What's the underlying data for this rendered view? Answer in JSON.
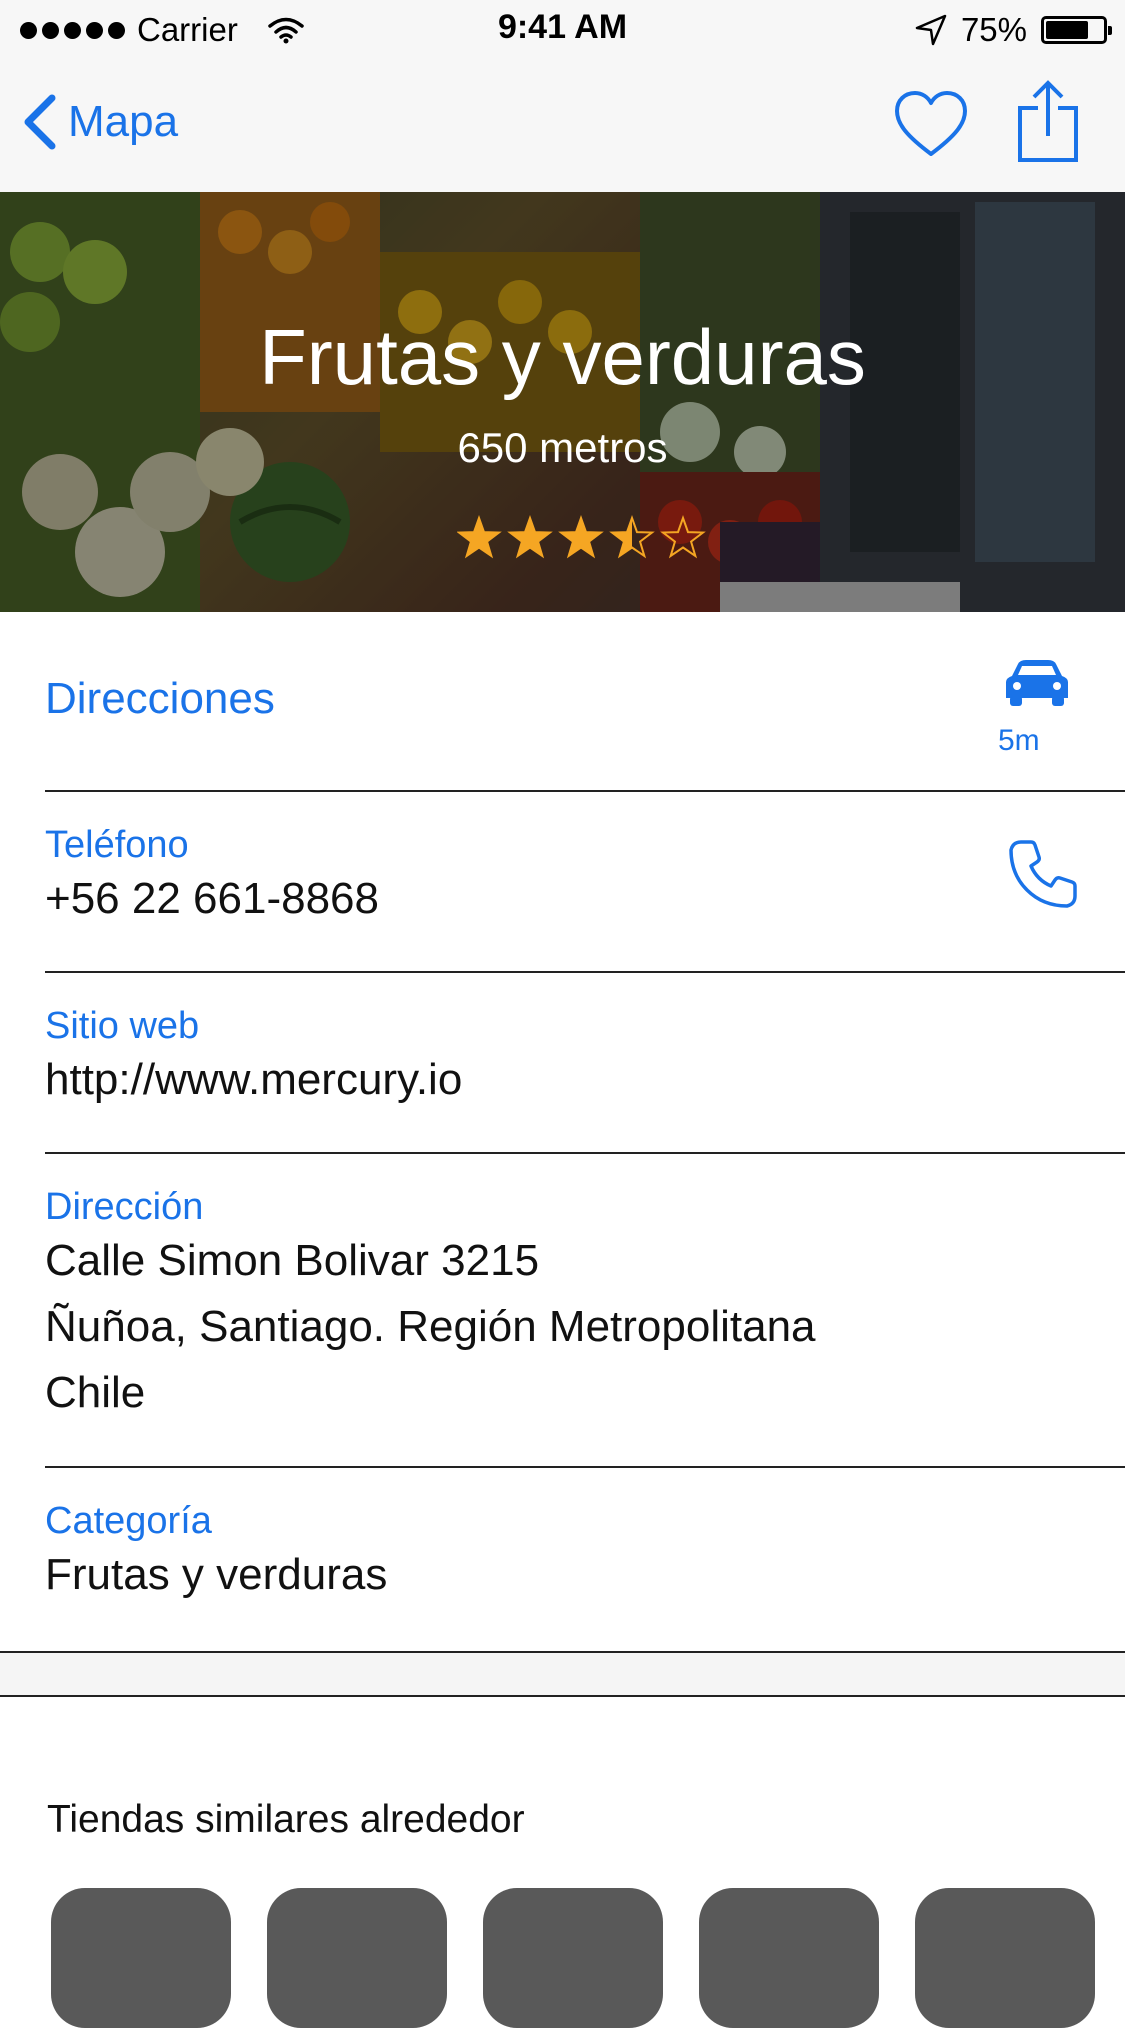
{
  "status_bar": {
    "carrier": "Carrier",
    "time": "9:41 AM",
    "battery": "75%",
    "battery_level": 0.75
  },
  "nav": {
    "back_label": "Mapa",
    "icons": [
      "chevron-left-icon",
      "heart-icon",
      "share-icon"
    ]
  },
  "hero": {
    "title": "Frutas y verduras",
    "distance": "650 metros",
    "rating": 3.5,
    "rating_max": 5,
    "star_color": "#f5a623"
  },
  "directions": {
    "label": "Direcciones",
    "eta": "5m",
    "icon": "car-icon"
  },
  "phone": {
    "label": "Teléfono",
    "value": "+56 22 661-8868",
    "icon": "phone-icon"
  },
  "website": {
    "label": "Sitio web",
    "value": "http://www.mercury.io"
  },
  "address": {
    "label": "Dirección",
    "lines": [
      "Calle Simon Bolivar 3215",
      "Ñuñoa, Santiago. Región Metropolitana",
      "Chile"
    ]
  },
  "category": {
    "label": "Categoría",
    "value": "Frutas y verduras"
  },
  "similar": {
    "title": "Tiendas similares alrededor",
    "tile_count": 5
  },
  "colors": {
    "accent": "#1a73e8",
    "nav_background": "#f7f7f7",
    "tile": "#595959"
  }
}
